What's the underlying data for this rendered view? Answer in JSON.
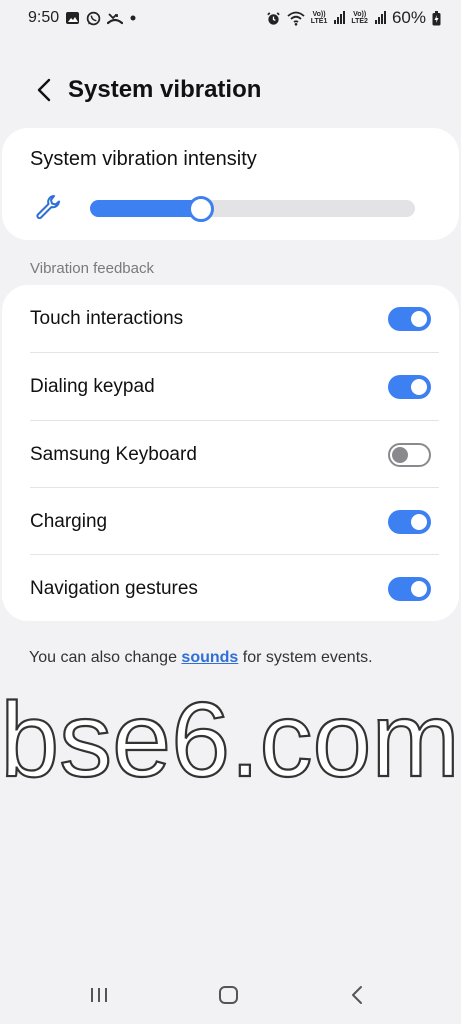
{
  "status_bar": {
    "time": "9:50",
    "left_icons": [
      "gallery-icon",
      "whatsapp-icon",
      "missed-call-icon",
      "dot-icon"
    ],
    "right_icons": [
      "alarm-icon",
      "wifi-icon",
      "lte1-signal-icon",
      "lte2-signal-icon",
      "battery-icon"
    ],
    "lte1_label_top": "Vo))",
    "lte1_label_bottom": "LTE1",
    "lte2_label_top": "Vo))",
    "lte2_label_bottom": "LTE2",
    "battery": "60%"
  },
  "header": {
    "title": "System vibration",
    "back_icon": "chevron-left-icon"
  },
  "intensity": {
    "title": "System vibration intensity",
    "icon": "wrench-icon",
    "level_fraction": 0.34
  },
  "section_label": "Vibration feedback",
  "settings": [
    {
      "label": "Touch interactions",
      "enabled": true
    },
    {
      "label": "Dialing keypad",
      "enabled": true
    },
    {
      "label": "Samsung Keyboard",
      "enabled": false
    },
    {
      "label": "Charging",
      "enabled": true
    },
    {
      "label": "Navigation gestures",
      "enabled": true
    }
  ],
  "footer": {
    "prefix": "You can also change ",
    "link": "sounds",
    "suffix": " for system events."
  },
  "watermark": "bse6.com",
  "nav": {
    "recents_icon": "recents-icon",
    "home_icon": "home-icon",
    "back_icon": "back-icon"
  },
  "colors": {
    "accent": "#3d80f2",
    "background": "#f2f2f4",
    "card": "#ffffff",
    "link": "#2f6fd6"
  }
}
